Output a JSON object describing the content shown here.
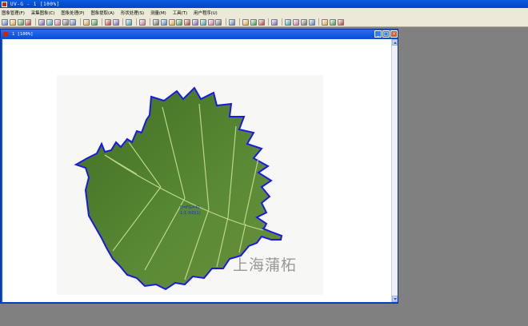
{
  "window": {
    "title": "UV-G - 1 [100%]"
  },
  "menu": [
    "图象管理(F)",
    "采集图象(C)",
    "图象处理(P)",
    "图象提取(A)",
    "形状处理(S)",
    "测量(M)",
    "工具(T)",
    "用户程序(U)"
  ],
  "toolbar_icons": [
    "open-icon",
    "new-icon",
    "folder-icon",
    "save-icon",
    "sep",
    "cut-icon",
    "camera-icon",
    "capture-icon",
    "capture2-icon",
    "capture3-icon",
    "sep",
    "video-icon",
    "save-copy-icon",
    "sep",
    "print-icon",
    "preview-icon",
    "sep",
    "list-icon",
    "sep",
    "color-icon",
    "sep",
    "grid-icon",
    "pen-icon",
    "fill-icon",
    "circle-icon",
    "target-icon",
    "measure-icon",
    "angle-icon",
    "line-icon",
    "lasso-icon",
    "sep",
    "magic-icon",
    "sep",
    "zoom-icon",
    "rotate-icon",
    "flip-icon",
    "sep",
    "hist-icon",
    "sep",
    "layers-icon",
    "split-icon",
    "merge-icon",
    "tile-icon",
    "sep",
    "help-icon",
    "grid2-icon",
    "about-icon"
  ],
  "child_window": {
    "title": "1 [100%]"
  },
  "image_overlay": {
    "annotation_line1": "D=FG=41",
    "annotation_line2": "1-1 XIO(1)",
    "watermark": "上海蒲柘"
  },
  "colors": {
    "titlebar": "#0543c4",
    "contour": "#1a1ae6",
    "leaf": "#4f7d2f",
    "menubar": "#ece9d8"
  }
}
